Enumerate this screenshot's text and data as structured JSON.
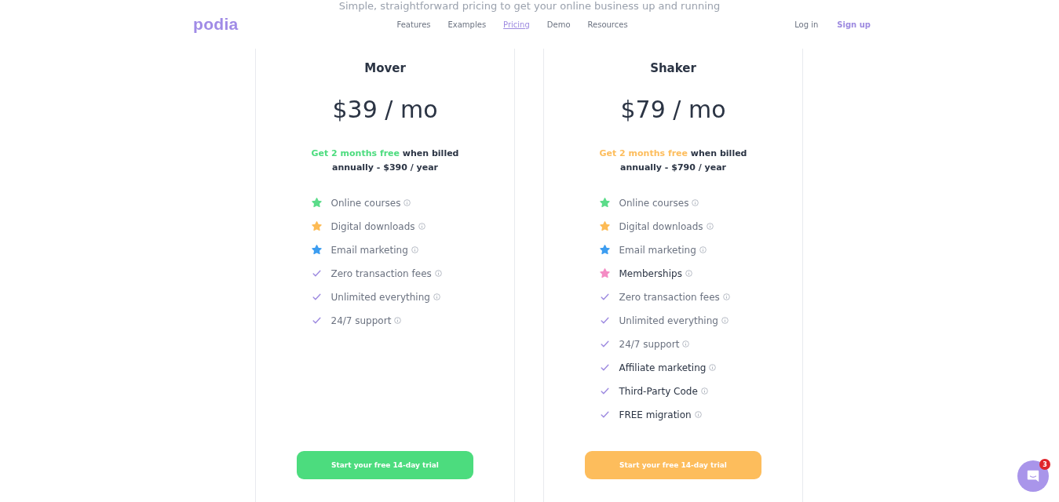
{
  "subtitle": "Simple, straightforward pricing to get your online business up and running",
  "header": {
    "logo": "podia",
    "nav": [
      {
        "label": "Features",
        "selected": false
      },
      {
        "label": "Examples",
        "selected": false
      },
      {
        "label": "Pricing",
        "selected": true
      },
      {
        "label": "Demo",
        "selected": false
      },
      {
        "label": "Resources",
        "selected": false
      }
    ],
    "login": "Log in",
    "signup": "Sign up"
  },
  "plans": [
    {
      "name": "Mover",
      "price": "$39 / mo",
      "color": "#4cdc7e",
      "promo_highlight": "Get 2 months free",
      "promo_text": "when billed annually - $390 / year",
      "button": "Start your free 14-day trial",
      "features": [
        {
          "kind": "star",
          "color": "#5cdc8a",
          "label": "Online courses",
          "emphasized": false
        },
        {
          "kind": "star",
          "color": "#fdbb55",
          "label": "Digital downloads",
          "emphasized": false
        },
        {
          "kind": "star",
          "color": "#3d9df0",
          "label": "Email marketing",
          "emphasized": false
        },
        {
          "kind": "check",
          "label": "Zero transaction fees",
          "emphasized": false
        },
        {
          "kind": "check",
          "label": "Unlimited everything",
          "emphasized": false
        },
        {
          "kind": "check",
          "label": "24/7 support",
          "emphasized": false
        }
      ]
    },
    {
      "name": "Shaker",
      "price": "$79 / mo",
      "color": "#fdbd5c",
      "promo_highlight": "Get 2 months free",
      "promo_text": "when billed annually - $790 / year",
      "button": "Start your free 14-day trial",
      "features": [
        {
          "kind": "star",
          "color": "#5cdc8a",
          "label": "Online courses",
          "emphasized": false
        },
        {
          "kind": "star",
          "color": "#fdbb55",
          "label": "Digital downloads",
          "emphasized": false
        },
        {
          "kind": "star",
          "color": "#3d9df0",
          "label": "Email marketing",
          "emphasized": false
        },
        {
          "kind": "star",
          "color": "#f48cc4",
          "label": "Memberships",
          "emphasized": true
        },
        {
          "kind": "check",
          "label": "Zero transaction fees",
          "emphasized": false
        },
        {
          "kind": "check",
          "label": "Unlimited everything",
          "emphasized": false
        },
        {
          "kind": "check",
          "label": "24/7 support",
          "emphasized": false
        },
        {
          "kind": "check",
          "label": "Affiliate marketing",
          "emphasized": true
        },
        {
          "kind": "check",
          "label": "Third-Party Code",
          "emphasized": true
        },
        {
          "kind": "check",
          "label": "FREE migration",
          "emphasized": true
        }
      ]
    }
  ],
  "chat": {
    "badge": "3"
  }
}
